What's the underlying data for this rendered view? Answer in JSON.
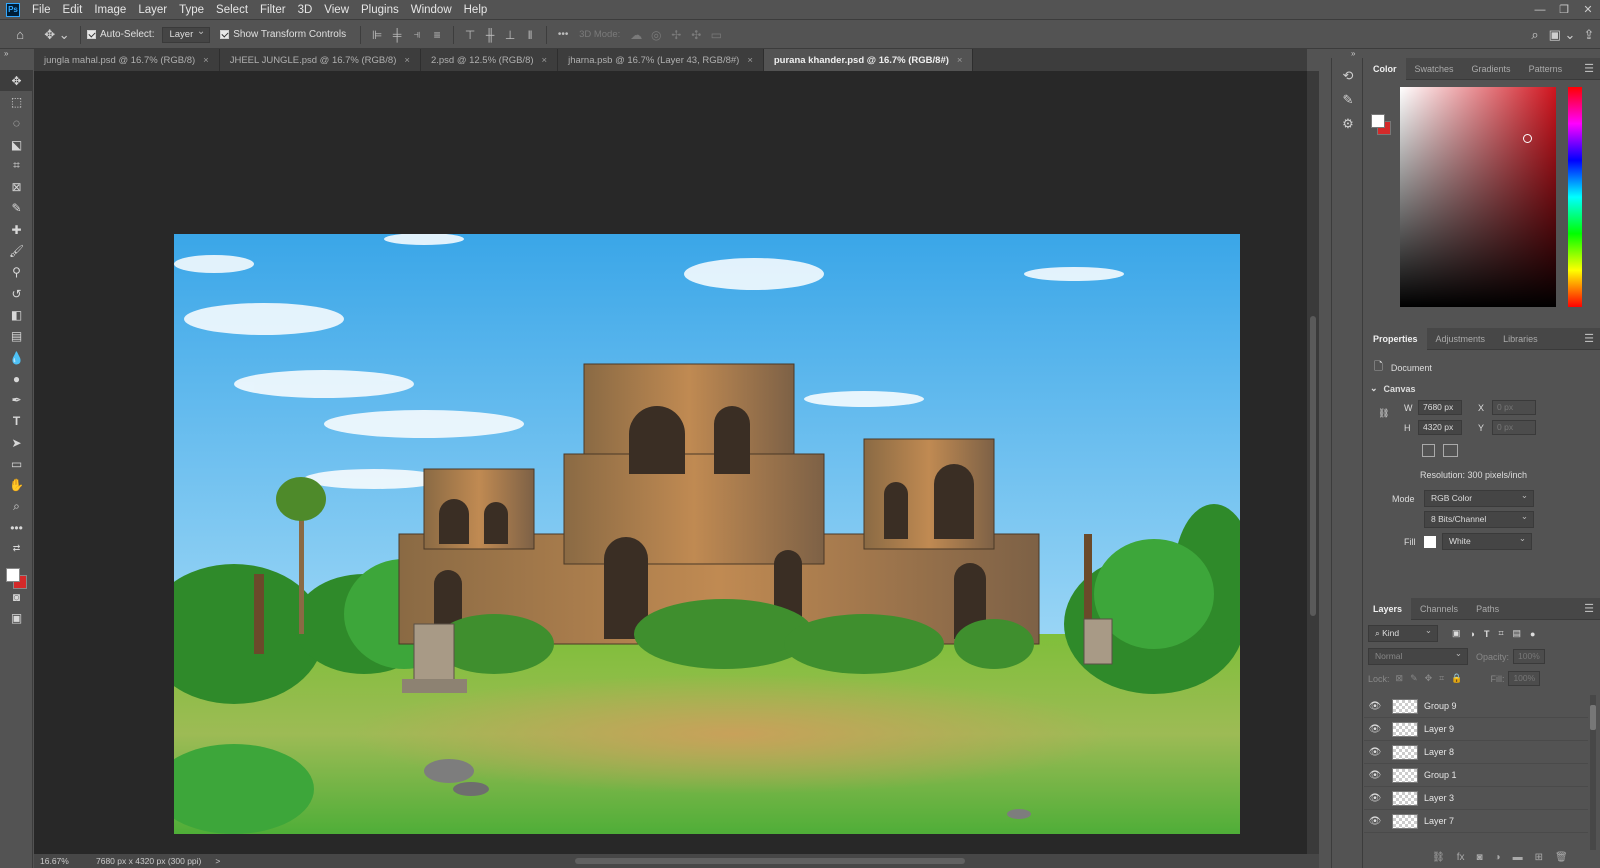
{
  "app": {
    "logo": "Ps"
  },
  "menu": [
    "File",
    "Edit",
    "Image",
    "Layer",
    "Type",
    "Select",
    "Filter",
    "3D",
    "View",
    "Plugins",
    "Window",
    "Help"
  ],
  "window_controls": {
    "minimize": "—",
    "restore": "❐",
    "close": "✕"
  },
  "options": {
    "auto_select_label": "Auto-Select:",
    "auto_select_value": "Layer",
    "show_transform_label": "Show Transform Controls",
    "more": "•••",
    "mode_3d_label": "3D Mode:"
  },
  "collapse_glyph": "»",
  "tabs": [
    {
      "label": "jungla mahal.psd @ 16.7% (RGB/8)",
      "active": false
    },
    {
      "label": "JHEEL JUNGLE.psd @ 16.7% (RGB/8)",
      "active": false
    },
    {
      "label": "2.psd @ 12.5% (RGB/8)",
      "active": false
    },
    {
      "label": "jharna.psb @ 16.7% (Layer 43, RGB/8#)",
      "active": false
    },
    {
      "label": "purana khander.psd @ 16.7% (RGB/8#)",
      "active": true
    }
  ],
  "tab_close": "×",
  "status": {
    "zoom": "16.67%",
    "doc_info": "7680 px x 4320 px (300 ppi)",
    "arrow": ">"
  },
  "color_panel": {
    "tabs": [
      "Color",
      "Swatches",
      "Gradients",
      "Patterns"
    ],
    "fg": "#ffffff",
    "bg": "#d42a2a"
  },
  "properties_panel": {
    "tabs": [
      "Properties",
      "Adjustments",
      "Libraries"
    ],
    "doc_label": "Document",
    "section": "Canvas",
    "w_label": "W",
    "w_value": "7680 px",
    "h_label": "H",
    "h_value": "4320 px",
    "x_label": "X",
    "x_value": "0 px",
    "y_label": "Y",
    "y_value": "0 px",
    "resolution": "Resolution: 300 pixels/inch",
    "mode_label": "Mode",
    "mode_value": "RGB Color",
    "bits_value": "8 Bits/Channel",
    "fill_label": "Fill",
    "fill_value": "White"
  },
  "layers_panel": {
    "tabs": [
      "Layers",
      "Channels",
      "Paths"
    ],
    "kind": "Kind",
    "blend": "Normal",
    "opacity_label": "Opacity:",
    "opacity_value": "100%",
    "lock_label": "Lock:",
    "fill_label": "Fill:",
    "fill_value": "100%",
    "layers": [
      "Group 9",
      "Layer 9",
      "Layer 8",
      "Group 1",
      "Layer 3",
      "Layer 7"
    ]
  }
}
